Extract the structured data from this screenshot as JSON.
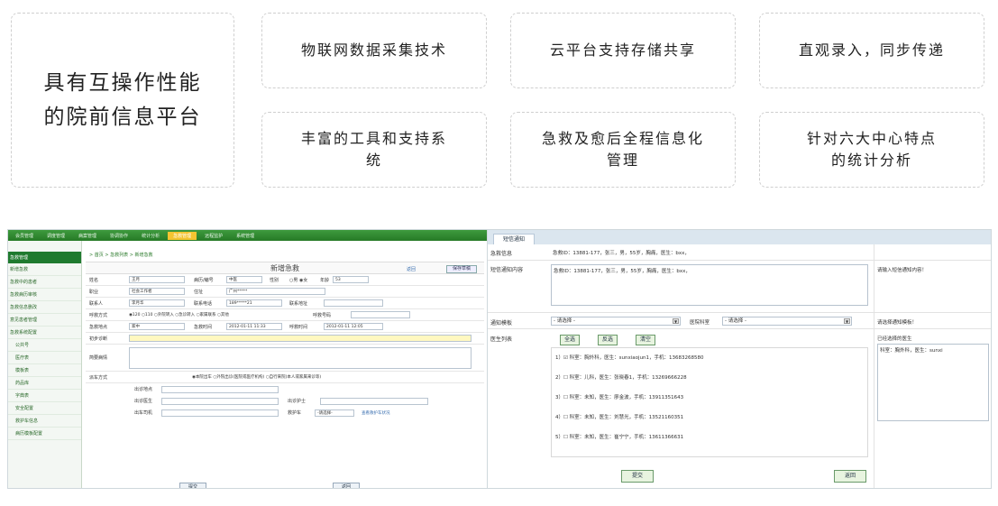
{
  "features": {
    "main_line1": "具有互操作性能",
    "main_line2": "的院前信息平台",
    "c1": "物联网数据采集技术",
    "c2": "云平台支持存储共享",
    "c3": "直观录入，同步传递",
    "c4_l1": "丰富的工具和支持系",
    "c4_l2": "统",
    "c5_l1": "急救及愈后全程信息化",
    "c5_l2": "管理",
    "c6_l1": "针对六大中心特点",
    "c6_l2": "的统计分析"
  },
  "left_app": {
    "topnav": [
      "会员管理",
      "调度管理",
      "病案管理",
      "协调协作",
      "统计分析",
      "急救管理",
      "远程监护",
      "系统管理"
    ],
    "sidebar_head": "急救管理",
    "sidebar": [
      "新增急救",
      "急救中的患者",
      "急救病历审核",
      "急救信息删改",
      "意见患者管理",
      "急救系统配置"
    ],
    "sidebar_sub": [
      "公共号",
      "医疗表",
      "模板表",
      "药品库",
      "字典表",
      "安全配置",
      "救护车信息",
      "病历模板配置"
    ],
    "breadcrumb": "> 首页 > 急救列表 > 新增急救",
    "form_title": "新增急救",
    "back": "返回",
    "save": "保存草稿",
    "rows": {
      "name_label": "姓名",
      "name_val": "王月",
      "id_label": "病历/编号",
      "id_val": "中医",
      "sex_label": "性别",
      "sex_val": "○男 ◉女",
      "age_label": "年龄",
      "age_val": "53",
      "unit_label": "职业",
      "unit_val": "社会工作者",
      "addr_label": "住址",
      "addr_val": "广州*****",
      "contact_label": "联系人",
      "contact_val": "李月华",
      "phone_label": "联系电话",
      "phone_val": "189*****21",
      "rel_label": "联系地址",
      "mode_label": "呼救方式",
      "mode_val": "◉120 ○110 ○外院转入 ○急诊转入 ○家属联系 ○其他",
      "callnum_label": "呼救号码",
      "place_label": "急救地点",
      "place_val": "家中",
      "time_label": "急救时间",
      "time_val": "2012-01-11 11:33",
      "rtime_label": "呼救时间",
      "rtime_val": "2012-01-11 12:05",
      "dx_label": "初步诊断",
      "hx_label": "简要病情",
      "way_label": "派车方式",
      "way_val": "◉本院出车 ○外院出诊(医院或医疗机构) ○自行来院(本人或家属来诊等)",
      "place2_label": "出诊地点",
      "doc_label": "出诊医生",
      "nurse_label": "出诊护士",
      "driver_label": "出车司机",
      "amb_label": "救护车",
      "amb_val": "-请选择-",
      "amb_link": "查看救护车状况"
    },
    "submit": "提交",
    "back2": "返回"
  },
  "right_app": {
    "tab": "短信通知",
    "info_label": "急救信息",
    "info_val": "急救ID：13881-177，张三，男，55岁，胸痛，医生：bxx，",
    "content_label": "短信通知内容",
    "content_val": "急救ID：13881-177，张三，男，55岁，胸痛，医生：bxx，",
    "content_hint": "请输入短信通知内容！",
    "tpl_label": "通知模板",
    "tpl_val": "- 请选择 -",
    "dept_label": "医院科室",
    "dept_val": "- 请选择 -",
    "tpl_hint": "请选择通知模板！",
    "docs_label": "医生列表",
    "btn_all": "全选",
    "btn_inv": "反选",
    "btn_clear": "清空",
    "selected_label": "已经选择的医生",
    "selected_val": "科室：胸外科，医生：sunxi",
    "doctors": [
      "1）☑ 科室：胸外科，医生：sunxiaojun1，手机：13683268580",
      "2）☐ 科室：儿科，医生：张晓春1，手机：13269666228",
      "3）☐ 科室：未知，医生：廖金波，手机：13911351643",
      "4）☐ 科室：未知，医生：刘慧光，手机：13521160351",
      "5）☐ 科室：未知，医生：崔宁宁，手机：13611366631"
    ],
    "submit": "提交",
    "back": "返回"
  }
}
